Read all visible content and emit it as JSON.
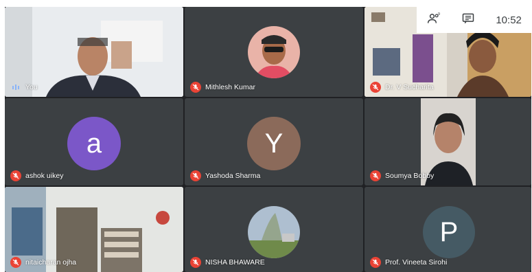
{
  "topbar": {
    "time": "10:52",
    "people_icon": "people-icon",
    "chat_icon": "chat-icon"
  },
  "tiles": [
    {
      "name": "You",
      "type": "video",
      "muted": false
    },
    {
      "name": "Mithlesh Kumar",
      "type": "photo-avatar",
      "muted": true
    },
    {
      "name": "Dr. V Sucharita",
      "type": "video",
      "muted": true
    },
    {
      "name": "ashok uikey",
      "type": "letter-avatar",
      "letter": "a",
      "color": "#7b57c8",
      "muted": true
    },
    {
      "name": "Yashoda Sharma",
      "type": "letter-avatar",
      "letter": "Y",
      "color": "#8b6a5a",
      "muted": true
    },
    {
      "name": "Soumya Bobby",
      "type": "video",
      "muted": true
    },
    {
      "name": "nitaicharan ojha",
      "type": "video",
      "muted": true
    },
    {
      "name": "NISHA BHAWARE",
      "type": "photo-avatar",
      "muted": true
    },
    {
      "name": "Prof. Vineeta Sirohi",
      "type": "letter-avatar",
      "letter": "P",
      "color": "#455a64",
      "muted": true
    }
  ],
  "colors": {
    "muted_red": "#ea4335",
    "tile_bg": "#3c4043",
    "grid_bg": "#202124"
  }
}
